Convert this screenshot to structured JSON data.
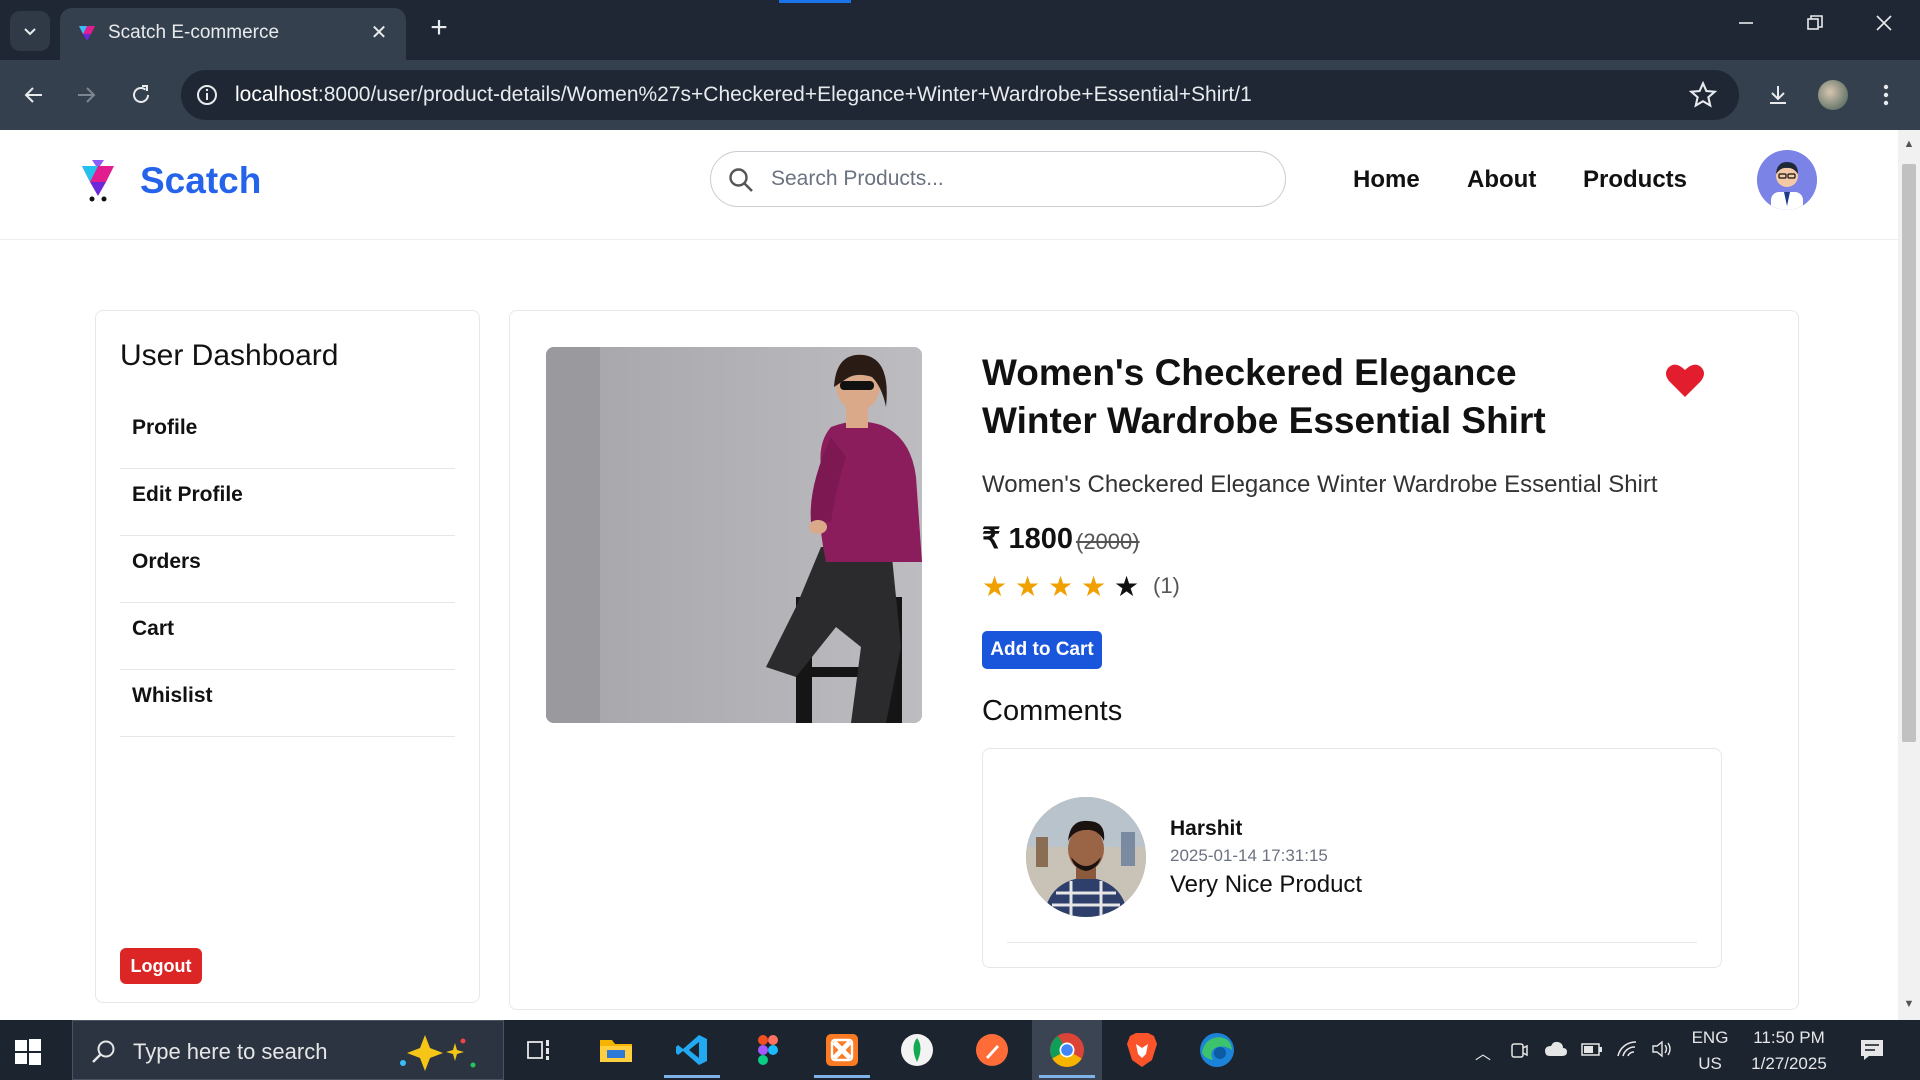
{
  "browser": {
    "tab_title": "Scatch E-commerce",
    "url_host": "localhost",
    "url_path": ":8000/user/product-details/Women%27s+Checkered+Elegance+Winter+Wardrobe+Essential+Shirt/1"
  },
  "header": {
    "logo_text": "Scatch",
    "search_placeholder": "Search Products...",
    "nav": [
      "Home",
      "About",
      "Products"
    ]
  },
  "sidebar": {
    "title": "User Dashboard",
    "items": [
      "Profile",
      "Edit Profile",
      "Orders",
      "Cart",
      "Whislist"
    ],
    "logout_label": "Logout"
  },
  "product": {
    "title": "Women's Checkered Elegance Winter Wardrobe Essential Shirt",
    "description": "Women's Checkered Elegance Winter Wardrobe Essential Shirt",
    "price": "₹ 1800",
    "mrp": "(2000)",
    "rating_stars": 4,
    "rating_max": 5,
    "rating_count": "(1)",
    "add_to_cart_label": "Add to Cart",
    "wishlisted": true
  },
  "comments": {
    "title": "Comments",
    "items": [
      {
        "name": "Harshit",
        "date": "2025-01-14 17:31:15",
        "text": "Very Nice Product"
      }
    ]
  },
  "taskbar": {
    "search_text": "Type here to search",
    "lang_top": "ENG",
    "lang_bottom": "US",
    "time": "11:50 PM",
    "date": "1/27/2025"
  },
  "colors": {
    "brand": "#2563eb",
    "heart": "#e11d2e",
    "star": "#f0a000",
    "logout": "#dc2626",
    "button": "#1a56db"
  }
}
